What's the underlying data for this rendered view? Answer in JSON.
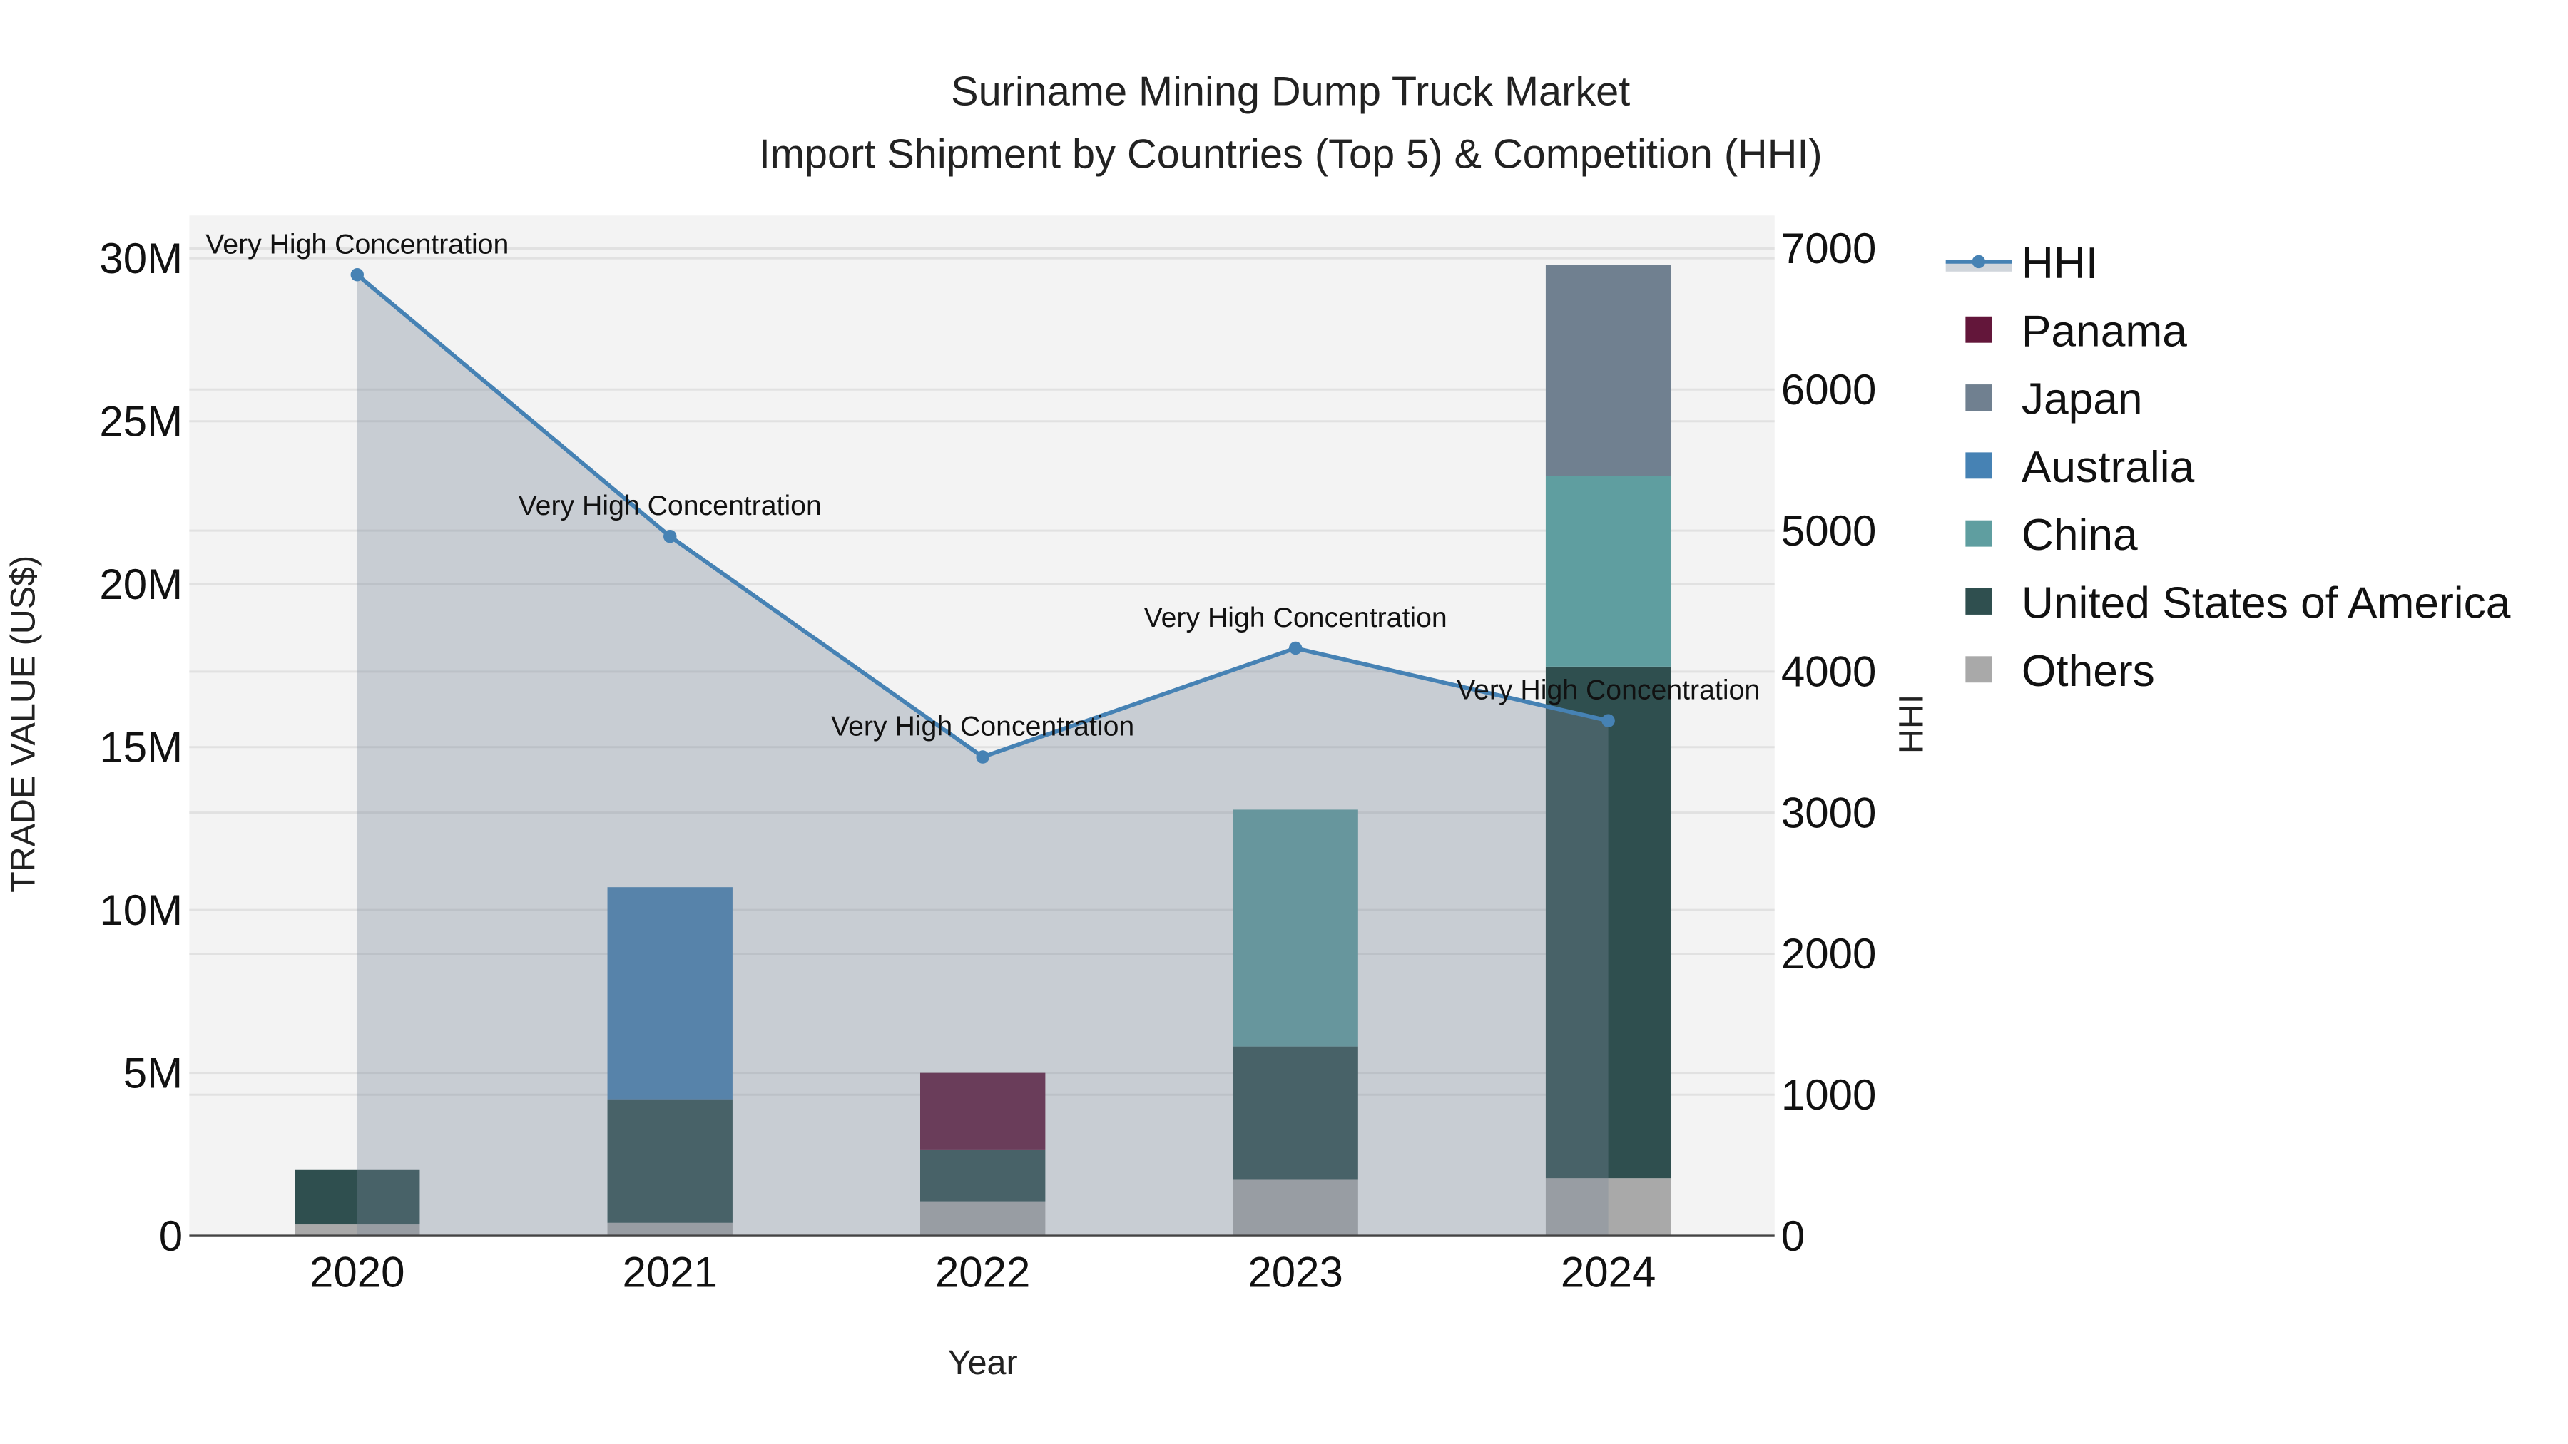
{
  "chart_data": {
    "type": "bar",
    "title": "Suriname Mining Dump Truck Market",
    "subtitle": "Import Shipment by Countries (Top 5) & Competition (HHI)",
    "xlabel": "Year",
    "ylabel": "TRADE VALUE (US$)",
    "y2label": "HHI",
    "categories": [
      "2020",
      "2021",
      "2022",
      "2023",
      "2024"
    ],
    "ylim": [
      0,
      31000000
    ],
    "y2lim": [
      0,
      7233
    ],
    "yticks": [
      0,
      5000000,
      10000000,
      15000000,
      20000000,
      25000000,
      30000000
    ],
    "ytick_labels": [
      "0",
      "5M",
      "10M",
      "15M",
      "20M",
      "25M",
      "30M"
    ],
    "y2ticks": [
      0,
      1000,
      2000,
      3000,
      4000,
      5000,
      6000,
      7000
    ],
    "y2tick_labels": [
      "0",
      "1000",
      "2000",
      "3000",
      "4000",
      "5000",
      "6000",
      "7000"
    ],
    "stacking": "stacked",
    "series": [
      {
        "name": "Others",
        "color": "#a9a9a9",
        "values": [
          350000,
          400000,
          1060000,
          1720000,
          1770000
        ]
      },
      {
        "name": "United States of America",
        "color": "#2f4f4f",
        "values": [
          1670000,
          3790000,
          1570000,
          4090000,
          15700000
        ]
      },
      {
        "name": "Panama",
        "color": "#63163a",
        "values": [
          0,
          0,
          2370000,
          0,
          0
        ]
      },
      {
        "name": "Australia",
        "color": "#4682b4",
        "values": [
          0,
          6510000,
          0,
          0,
          0
        ]
      },
      {
        "name": "China",
        "color": "#5f9ea0",
        "values": [
          0,
          0,
          0,
          7270000,
          5860000
        ]
      },
      {
        "name": "Japan",
        "color": "#708090",
        "values": [
          0,
          0,
          0,
          0,
          6470000
        ]
      }
    ],
    "line": {
      "name": "HHI",
      "color": "#4682b4",
      "axis": "right",
      "values": [
        6814,
        4959,
        3395,
        4166,
        3652
      ],
      "annotations": [
        "Very High Concentration",
        "Very High Concentration",
        "Very High Concentration",
        "Very High Concentration",
        "Very High Concentration"
      ]
    },
    "legend": {
      "placement": "right",
      "items": [
        "HHI",
        "Panama",
        "Japan",
        "Australia",
        "China",
        "United States of America",
        "Others"
      ]
    },
    "grid": true
  }
}
